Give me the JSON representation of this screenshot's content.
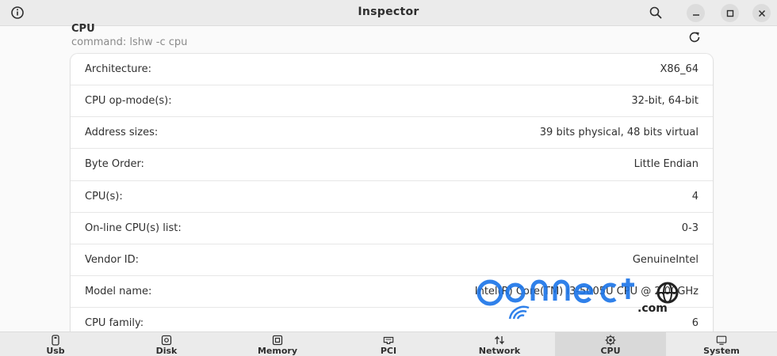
{
  "window": {
    "title": "Inspector",
    "icons": {
      "info": "info-icon",
      "search": "search-icon",
      "minimize": "minimize-icon",
      "maximize": "maximize-icon",
      "close": "close-icon"
    }
  },
  "header": {
    "title": "CPU",
    "command": "command: lshw -c cpu",
    "refresh_icon": "refresh-icon"
  },
  "rows": [
    {
      "key": "Architecture:",
      "value": "X86_64"
    },
    {
      "key": "CPU op-mode(s):",
      "value": "32-bit, 64-bit"
    },
    {
      "key": "Address sizes:",
      "value": "39 bits physical, 48 bits virtual"
    },
    {
      "key": "Byte Order:",
      "value": "Little Endian"
    },
    {
      "key": "CPU(s):",
      "value": "4"
    },
    {
      "key": "On-line CPU(s) list:",
      "value": "0-3"
    },
    {
      "key": "Vendor ID:",
      "value": "GenuineIntel"
    },
    {
      "key": "Model name:",
      "value": "Intel(R) Core(TM) i3-5005U CPU @ 2.00GHz"
    },
    {
      "key": "CPU family:",
      "value": "6"
    }
  ],
  "watermark": {
    "text": "Connect",
    "suffix": ".com"
  },
  "tabs": [
    {
      "label": "Usb",
      "icon": "usb-icon",
      "active": false
    },
    {
      "label": "Disk",
      "icon": "disk-icon",
      "active": false
    },
    {
      "label": "Memory",
      "icon": "memory-icon",
      "active": false
    },
    {
      "label": "PCI",
      "icon": "pci-icon",
      "active": false
    },
    {
      "label": "Network",
      "icon": "network-icon",
      "active": false
    },
    {
      "label": "CPU",
      "icon": "cpu-icon",
      "active": true
    },
    {
      "label": "System",
      "icon": "system-icon",
      "active": false
    }
  ],
  "colors": {
    "titlebar": "#ebebeb",
    "background": "#fafafa",
    "card": "#ffffff",
    "active_tab": "#d9d9d9",
    "watermark": "#1a73e8"
  }
}
